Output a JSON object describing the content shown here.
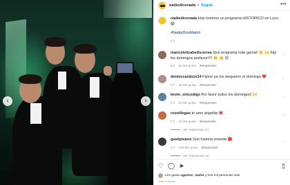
{
  "header": {
    "username": "nadiedicenada",
    "separator": "•",
    "follow_label": "Seguir",
    "more_icon": "more-horizontal-icon"
  },
  "caption": {
    "username": "nadiedicenada",
    "text": "Hoy tuvimos un programa HISTÓRICO en Luzu 😱",
    "hashtag": "#NadieDiceMatch",
    "time": "5 h"
  },
  "comments": [
    {
      "username": "maricelelizabethcorrea",
      "text": "Que programa más genial! 👏 🙌 Fijo los domingos porfavor!!!! 👏 👏 😍",
      "time": "5 h",
      "likes": "20 Me gusta",
      "reply_label": "Responder",
      "avatar_color": "#8a6b58"
    },
    {
      "username": "denisecardozo14",
      "text": "Fijooo ya me alegraron el domingo ❤️",
      "time": "5 h",
      "likes": "20 Me gusta",
      "reply_label": "Responder",
      "avatar_color": "#b08d86"
    },
    {
      "username": "kevin_sincodigo",
      "text": "Por favor todos los domingos! 🙌",
      "time": "5 h",
      "likes": "20 Me gusta",
      "reply_label": "Responder",
      "avatar_color": "#5f7fa0"
    },
    {
      "username": "roovillegas",
      "text": "te amo angelita 💗",
      "time": "5 h",
      "likes": "24 Me gusta",
      "reply_label": "Responder",
      "view_replies": "Ver respuestas (1)",
      "avatar_color": "#c46b3d"
    },
    {
      "username": "gastipisano",
      "text": "Son historia viviente 🔴",
      "time": "5 h",
      "likes": "232 Me gusta",
      "reply_label": "Responder",
      "view_replies": "Ver respuestas (2)",
      "avatar_color": "#3a3a3a"
    }
  ],
  "footer": {
    "likes_text_prefix": "Les gusta a ",
    "likes_user": "gaston_mafut",
    "likes_text_suffix": " y 104 mil personas más",
    "date": "Hace 5 horas"
  }
}
